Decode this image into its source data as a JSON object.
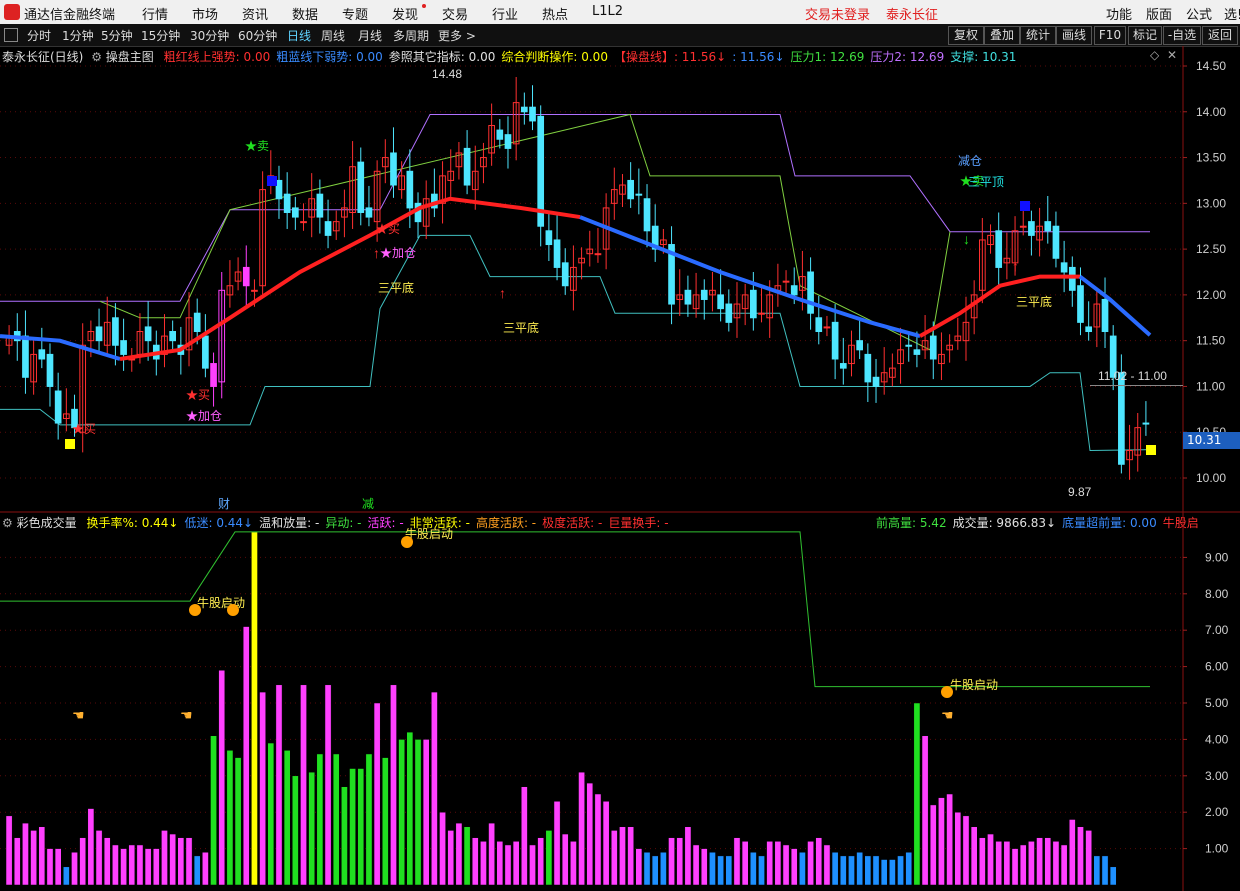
{
  "menubar": {
    "app_title": "通达信金融终端",
    "items": [
      "行情",
      "市场",
      "资讯",
      "数据",
      "专题",
      "发现",
      "交易",
      "行业",
      "热点",
      "L1L2"
    ],
    "status_login": "交易未登录",
    "stock_name": "泰永长征",
    "right_items": [
      "功能",
      "版面",
      "公式",
      "选!"
    ]
  },
  "toolbar": {
    "periods": [
      "分时",
      "1分钟",
      "5分钟",
      "15分钟",
      "30分钟",
      "60分钟",
      "日线",
      "周线",
      "月线",
      "多周期",
      "更多 >"
    ],
    "active_period": "日线",
    "right_buttons": [
      "复权",
      "叠加",
      "统计",
      "画线",
      "F10",
      "标记",
      "-自选",
      "返回"
    ]
  },
  "main_info": {
    "title": "泰永长征(日线)",
    "indicator": "操盘主图",
    "fields": [
      {
        "label": "粗红线上强势: ",
        "value": "0.00",
        "color": "#ff3030"
      },
      {
        "label": "粗蓝线下弱势: ",
        "value": "0.00",
        "color": "#3a8bff"
      },
      {
        "label": "参照其它指标: ",
        "value": "0.00",
        "color": "#e0e0e0"
      },
      {
        "label": "综合判断操作: ",
        "value": "0.00",
        "color": "#ffff00"
      },
      {
        "label": "【操盘线】: ",
        "value": "11.56↓",
        "color": "#ff3030"
      },
      {
        "label": ": ",
        "value": "11.56↓",
        "color": "#3a8bff"
      },
      {
        "label": "压力1: ",
        "value": "12.69",
        "color": "#40e040"
      },
      {
        "label": "压力2: ",
        "value": "12.69",
        "color": "#c070ff"
      },
      {
        "label": "支撑: ",
        "value": "10.31",
        "color": "#40e0e0"
      }
    ]
  },
  "vol_info": {
    "title": "彩色成交量",
    "fields": [
      {
        "label": "换手率%: ",
        "value": "0.44↓",
        "color": "#ffff00"
      },
      {
        "label": "低迷: ",
        "value": "0.44↓",
        "color": "#3a8bff"
      },
      {
        "label": "温和放量: ",
        "value": "-",
        "color": "#e0e0e0"
      },
      {
        "label": "异动: ",
        "value": "-",
        "color": "#40e040"
      },
      {
        "label": "活跃: ",
        "value": "-",
        "color": "#ff40ff"
      },
      {
        "label": "非常活跃: ",
        "value": "-",
        "color": "#ffff00"
      },
      {
        "label": "高度活跃: ",
        "value": "-",
        "color": "#ffa020"
      },
      {
        "label": "极度活跃: ",
        "value": "-",
        "color": "#ff3030"
      },
      {
        "label": "巨量换手: ",
        "value": "-",
        "color": "#ff3030"
      }
    ],
    "right_fields": [
      {
        "label": "前高量: ",
        "value": "5.42",
        "color": "#40e040"
      },
      {
        "label": "成交量: ",
        "value": "9866.83↓",
        "color": "#e0e0e0"
      },
      {
        "label": "底量超前量: ",
        "value": "0.00",
        "color": "#3a8bff"
      },
      {
        "label": "牛股启",
        "value": "",
        "color": "#ff3030"
      }
    ]
  },
  "price_axis": {
    "ticks": [
      "14.50",
      "14.00",
      "13.50",
      "13.00",
      "12.50",
      "12.00",
      "11.50",
      "11.00",
      "10.50",
      "10.00"
    ],
    "current": "10.31"
  },
  "vol_axis": {
    "ticks": [
      "9.00",
      "8.00",
      "7.00",
      "6.00",
      "5.00",
      "4.00",
      "3.00",
      "2.00",
      "1.00"
    ]
  },
  "annotations": {
    "high": "14.48",
    "low": "9.87",
    "range_label": "11.02 - 11.00",
    "marker_cai": "财",
    "marker_jian": "减",
    "sell": "★卖",
    "buy": "★买",
    "add": "★加仓",
    "reduce": "减仓",
    "triple_bottom": "三平底",
    "triple_top": "三平顶",
    "bull_start": "牛股启动"
  },
  "colors": {
    "up": "#ff3030",
    "down": "#4ee6ff",
    "up_thick": "#ff2020",
    "down_thick": "#2a6bff",
    "purple": "#b070ff",
    "green_line": "#80d040",
    "support": "#40c0c0",
    "magenta": "#ff40ff",
    "vol_green": "#20e020",
    "vol_blue": "#1e90ff",
    "vol_yellow": "#ffff00"
  },
  "chart_data": {
    "type": "candlestick",
    "title": "泰永长征(日线)",
    "series": [
      {
        "name": "price",
        "values": [
          11.55,
          11.5,
          11.1,
          11.35,
          11.3,
          11.0,
          10.6,
          10.7,
          10.55,
          11.45,
          11.6,
          11.5,
          11.7,
          11.45,
          11.35,
          11.3,
          11.6,
          11.5,
          11.3,
          11.55,
          11.5,
          11.35,
          11.75,
          11.6,
          11.2,
          11.0,
          12.05,
          12.1,
          12.25,
          12.1,
          12.05,
          13.15,
          13.3,
          13.05,
          12.9,
          12.85,
          12.8,
          13.05,
          12.85,
          12.65,
          12.8,
          12.95,
          13.4,
          12.9,
          12.85,
          13.35,
          13.5,
          13.2,
          13.3,
          12.95,
          12.8,
          13.05,
          12.95,
          13.3,
          13.35,
          13.55,
          13.2,
          13.35,
          13.5,
          13.85,
          13.7,
          13.6,
          14.1,
          14.0,
          13.9,
          12.75,
          12.55,
          12.3,
          12.1,
          12.3,
          12.4,
          12.5,
          12.45,
          12.95,
          13.15,
          13.2,
          13.05,
          13.1,
          12.7,
          12.5,
          12.6,
          11.9,
          12.0,
          11.9,
          12.0,
          11.95,
          12.05,
          11.85,
          11.7,
          11.9,
          12.0,
          11.75,
          11.8,
          12.0,
          12.1,
          12.15,
          12.0,
          12.2,
          11.8,
          11.6,
          11.65,
          11.3,
          11.2,
          11.45,
          11.4,
          11.05,
          11.0,
          11.15,
          11.2,
          11.4,
          11.45,
          11.35,
          11.5,
          11.3,
          11.35,
          11.45,
          11.55,
          11.7,
          12.0,
          12.6,
          12.65,
          12.3,
          12.4,
          12.7,
          12.75,
          12.65,
          12.75,
          12.7,
          12.4,
          12.25,
          12.05,
          11.7,
          11.6,
          11.9,
          11.6,
          11.1,
          10.15,
          10.3,
          10.55,
          10.6
        ]
      },
      {
        "name": "volume",
        "values": [
          1.9,
          1.3,
          1.7,
          1.5,
          1.6,
          1.0,
          1.0,
          0.5,
          0.9,
          1.3,
          2.1,
          1.5,
          1.3,
          1.1,
          1.0,
          1.1,
          1.1,
          1.0,
          1.0,
          1.5,
          1.4,
          1.3,
          1.3,
          0.8,
          0.9,
          4.1,
          5.9,
          3.7,
          3.5,
          7.1,
          9.7,
          5.3,
          3.9,
          5.5,
          3.7,
          3.0,
          5.5,
          3.1,
          3.6,
          5.5,
          3.6,
          2.7,
          3.2,
          3.2,
          3.6,
          5.0,
          3.5,
          5.5,
          4.0,
          4.2,
          4.0,
          4.0,
          5.3,
          2.0,
          1.5,
          1.7,
          1.6,
          1.3,
          1.2,
          1.7,
          1.2,
          1.1,
          1.2,
          2.7,
          1.1,
          1.3,
          1.5,
          2.3,
          1.4,
          1.2,
          3.1,
          2.8,
          2.5,
          2.3,
          1.5,
          1.6,
          1.6,
          1.0,
          0.9,
          0.8,
          0.9,
          1.3,
          1.3,
          1.6,
          1.1,
          1.0,
          0.9,
          0.8,
          0.8,
          1.3,
          1.2,
          0.9,
          0.8,
          1.2,
          1.2,
          1.1,
          1.0,
          0.9,
          1.2,
          1.3,
          1.1,
          0.9,
          0.8,
          0.8,
          0.9,
          0.8,
          0.8,
          0.7,
          0.7,
          0.8,
          0.9,
          5.0,
          4.1,
          2.2,
          2.4,
          2.5,
          2.0,
          1.9,
          1.6,
          1.3,
          1.4,
          1.2,
          1.2,
          1.0,
          1.1,
          1.2,
          1.3,
          1.3,
          1.2,
          1.1,
          1.8,
          1.6,
          1.5,
          0.8,
          0.8,
          0.5
        ]
      }
    ],
    "ylim_price": [
      9.8,
      14.6
    ],
    "ylim_volume": [
      0,
      10
    ]
  }
}
